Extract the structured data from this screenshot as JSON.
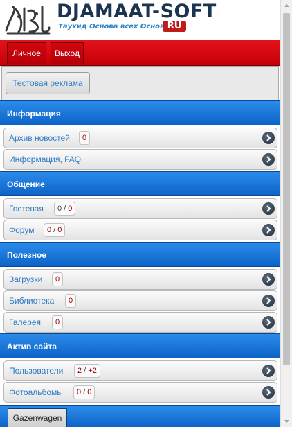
{
  "header": {
    "title": "DJAMAAT-SOFT",
    "slogan": "Таухид Основа всех Основ!!!",
    "ru_badge": "RU"
  },
  "topnav": {
    "personal": "Личное",
    "logout": "Выход"
  },
  "ad": {
    "button": "Тестовая реклама"
  },
  "sections": {
    "info": {
      "title": "Информация",
      "items": [
        {
          "label": "Архив новостей",
          "count": "0"
        },
        {
          "label": "Информация, FAQ"
        }
      ]
    },
    "social": {
      "title": "Общение",
      "items": [
        {
          "label": "Гостевая",
          "count_a": "0",
          "count_b": "0"
        },
        {
          "label": "Форум",
          "count_a": "0",
          "count_b": "0"
        }
      ]
    },
    "useful": {
      "title": "Полезное",
      "items": [
        {
          "label": "Загрузки",
          "count": "0"
        },
        {
          "label": "Библиотека",
          "count": "0"
        },
        {
          "label": "Галерея",
          "count": "0"
        }
      ]
    },
    "active": {
      "title": "Актив сайта",
      "items": [
        {
          "label": "Пользователи",
          "count_a": "2",
          "count_b": "+2"
        },
        {
          "label": "Фотоальбомы",
          "count_a": "0",
          "count_b": "0"
        }
      ]
    }
  },
  "footer": {
    "button": "Gazenwagen"
  },
  "colors": {
    "nav_red": "#d10a12",
    "section_blue": "#1a74da",
    "link_blue": "#2f7ac2",
    "count_red": "#a10000"
  },
  "icons": {
    "item_arrow": "chevron-right-icon"
  }
}
